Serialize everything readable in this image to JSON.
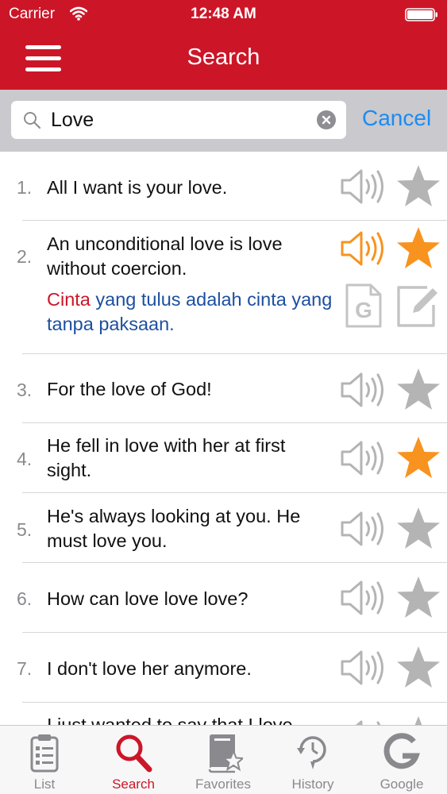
{
  "status": {
    "carrier": "Carrier",
    "time": "12:48 AM"
  },
  "nav": {
    "title": "Search"
  },
  "search": {
    "value": "Love",
    "cancel_label": "Cancel"
  },
  "results": [
    {
      "num": "1.",
      "text": "All I want is your love.",
      "favorite": false,
      "speaking": false
    },
    {
      "num": "2.",
      "text": "An unconditional love is love without coercion.",
      "translation_highlight": "Cinta",
      "translation_rest": " yang tulus adalah cinta yang tanpa paksaan.",
      "favorite": true,
      "speaking": true
    },
    {
      "num": "3.",
      "text": "For the love of God!",
      "favorite": false,
      "speaking": false
    },
    {
      "num": "4.",
      "text": "He fell in love with her at first sight.",
      "favorite": true,
      "speaking": false
    },
    {
      "num": "5.",
      "text": "He's always looking at you. He must love you.",
      "favorite": false,
      "speaking": false
    },
    {
      "num": "6.",
      "text": "How can love love love?",
      "favorite": false,
      "speaking": false
    },
    {
      "num": "7.",
      "text": "I don't love her anymore.",
      "favorite": false,
      "speaking": false
    },
    {
      "num": "8.",
      "text": "I just wanted to say that I love",
      "favorite": false,
      "speaking": false
    }
  ],
  "tabs": [
    {
      "label": "List",
      "icon": "clipboard-list-icon"
    },
    {
      "label": "Search",
      "icon": "magnifier-icon"
    },
    {
      "label": "Favorites",
      "icon": "book-star-icon"
    },
    {
      "label": "History",
      "icon": "history-clock-icon"
    },
    {
      "label": "Google",
      "icon": "google-g-icon"
    }
  ],
  "colors": {
    "brand_red": "#cc1628",
    "accent_orange": "#f7931e",
    "inactive_gray": "#b4b4b4",
    "link_blue": "#1a8cf2",
    "translation_blue": "#1c4fa0"
  }
}
